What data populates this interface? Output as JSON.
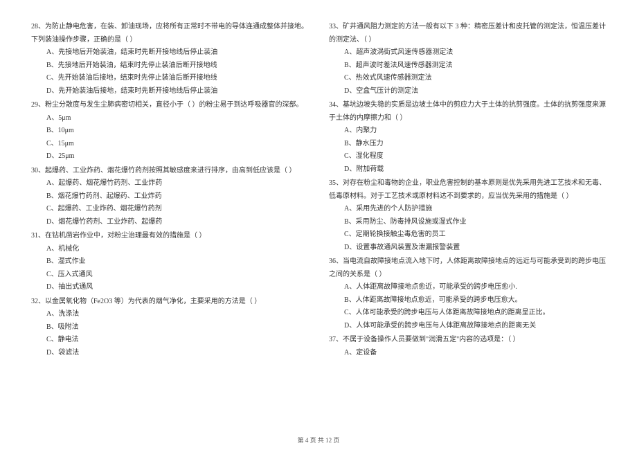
{
  "left": {
    "q28": {
      "text": "28、为防止静电危害，在装、卸油现场，应将所有正常时不带电的导体连通成整体并接地。下列装油操作步骤，正确的是（    ）",
      "a": "A、先接地后开始装油，结束时先断开接地线后停止装油",
      "b": "B、先接地后开始装油，结束时先停止装油后断开接地线",
      "c": "C、先开始装油后接地，结束时先停止装油后断开接地线",
      "d": "D、先开始装油后接地，结束时先断开接地线后停止装油"
    },
    "q29": {
      "text": "29、粉尘分散度与发生尘肺病密切相关，直径小于（    ）的粉尘易于到达呼吸器官的深部。",
      "a": "A、5μm",
      "b": "B、10μm",
      "c": "C、15μm",
      "d": "D、25μm"
    },
    "q30": {
      "text": "30、起爆药、工业炸药、烟花爆竹药剂按照其敏感度来进行排序，由高到低应该是（    ）",
      "a": "A、起爆药、烟花爆竹药剂、工业炸药",
      "b": "B、烟花爆竹药剂、起爆药、工业炸药",
      "c": "C、起爆药、工业炸药、烟花爆竹药剂",
      "d": "D、烟花爆竹药剂、工业炸药、起爆药"
    },
    "q31": {
      "text": "31、在钻机凿岩作业中，对粉尘治理最有效的措施是（    ）",
      "a": "A、机械化",
      "b": "B、湿式作业",
      "c": "C、压入式通风",
      "d": "D、抽出式通风"
    },
    "q32": {
      "text": "32、以金属氧化物（Fe2O3 等）为代表的烟气净化，主要采用的方法是（    ）",
      "a": "A、洗涤法",
      "b": "B、吸附法",
      "c": "C、静电法",
      "d": "D、袋滤法"
    }
  },
  "right": {
    "q33": {
      "text": "33、矿井通风阻力测定的方法一般有以下 3 种：精密压差计和皮托管的测定法，恒温压差计的测定法、（    ）",
      "a": "A、超声波涡街式风速传感器测定法",
      "b": "B、超声波时差法风速传感器测定法",
      "c": "C、热效式风速传感器测定法",
      "d": "D、空盒气压计的测定法"
    },
    "q34": {
      "text": "34、基坑边坡失稳的实质是边坡土体中的剪应力大于土体的抗剪强度。土体的抗剪强度来源于土体的内摩擦力和（    ）",
      "a": "A、内聚力",
      "b": "B、静水压力",
      "c": "C、湿化程度",
      "d": "D、附加荷载"
    },
    "q35": {
      "text": "35、对存在粉尘和毒物的企业，职业危害控制的基本原则是优先采用先进工艺技术和无毒、低毒原材料。对于工艺技术或原材料达不到要求的，应当优先采用的措施是（    ）",
      "a": "A、采用先进的个人防护措施",
      "b": "B、采用防尘、防毒排风设施或湿式作业",
      "c": "C、定期轮换接触尘毒危害的员工",
      "d": "D、设置事故通风装置及泄漏报警装置"
    },
    "q36": {
      "text": "36、当电流自故障接地点流入地下时，人体距离故障接地点的远近与可能承受到的跨步电压之间的关系是（    ）",
      "a": "A、人体距离故障接地点愈近，可能承受的跨步电压愈小.",
      "b": "B、人体距离故障接地点愈近，可能承受的跨步电压愈大。",
      "c": "C、人体可能承受的跨步电压与人体距离故障接地点的距离呈正比。",
      "d": "D、人体可能承受的跨步电压与人体距离故障接地点的距离无关"
    },
    "q37": {
      "text": "37、不属于设备操作人员要做到\"润滑五定\"内容的选项是：（    ）",
      "a": "A、定设备"
    }
  },
  "footer": "第 4 页 共 12 页"
}
